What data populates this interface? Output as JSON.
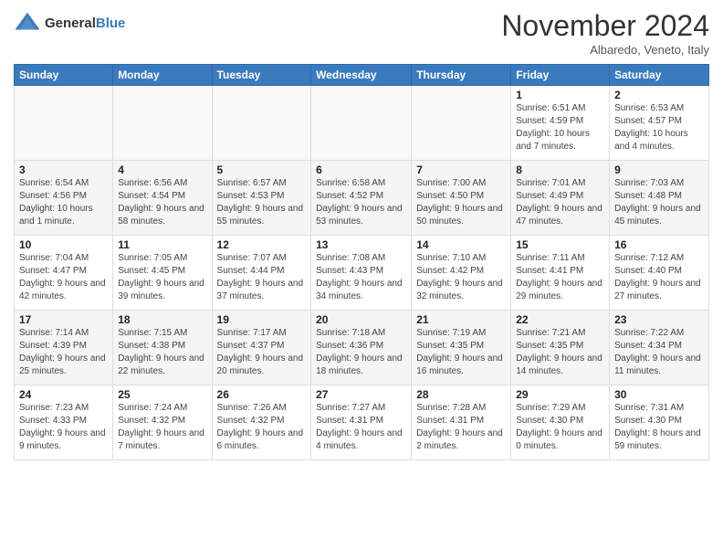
{
  "logo": {
    "general": "General",
    "blue": "Blue"
  },
  "header": {
    "month": "November 2024",
    "location": "Albaredo, Veneto, Italy"
  },
  "weekdays": [
    "Sunday",
    "Monday",
    "Tuesday",
    "Wednesday",
    "Thursday",
    "Friday",
    "Saturday"
  ],
  "weeks": [
    [
      {
        "day": "",
        "info": ""
      },
      {
        "day": "",
        "info": ""
      },
      {
        "day": "",
        "info": ""
      },
      {
        "day": "",
        "info": ""
      },
      {
        "day": "",
        "info": ""
      },
      {
        "day": "1",
        "info": "Sunrise: 6:51 AM\nSunset: 4:59 PM\nDaylight: 10 hours and 7 minutes."
      },
      {
        "day": "2",
        "info": "Sunrise: 6:53 AM\nSunset: 4:57 PM\nDaylight: 10 hours and 4 minutes."
      }
    ],
    [
      {
        "day": "3",
        "info": "Sunrise: 6:54 AM\nSunset: 4:56 PM\nDaylight: 10 hours and 1 minute."
      },
      {
        "day": "4",
        "info": "Sunrise: 6:56 AM\nSunset: 4:54 PM\nDaylight: 9 hours and 58 minutes."
      },
      {
        "day": "5",
        "info": "Sunrise: 6:57 AM\nSunset: 4:53 PM\nDaylight: 9 hours and 55 minutes."
      },
      {
        "day": "6",
        "info": "Sunrise: 6:58 AM\nSunset: 4:52 PM\nDaylight: 9 hours and 53 minutes."
      },
      {
        "day": "7",
        "info": "Sunrise: 7:00 AM\nSunset: 4:50 PM\nDaylight: 9 hours and 50 minutes."
      },
      {
        "day": "8",
        "info": "Sunrise: 7:01 AM\nSunset: 4:49 PM\nDaylight: 9 hours and 47 minutes."
      },
      {
        "day": "9",
        "info": "Sunrise: 7:03 AM\nSunset: 4:48 PM\nDaylight: 9 hours and 45 minutes."
      }
    ],
    [
      {
        "day": "10",
        "info": "Sunrise: 7:04 AM\nSunset: 4:47 PM\nDaylight: 9 hours and 42 minutes."
      },
      {
        "day": "11",
        "info": "Sunrise: 7:05 AM\nSunset: 4:45 PM\nDaylight: 9 hours and 39 minutes."
      },
      {
        "day": "12",
        "info": "Sunrise: 7:07 AM\nSunset: 4:44 PM\nDaylight: 9 hours and 37 minutes."
      },
      {
        "day": "13",
        "info": "Sunrise: 7:08 AM\nSunset: 4:43 PM\nDaylight: 9 hours and 34 minutes."
      },
      {
        "day": "14",
        "info": "Sunrise: 7:10 AM\nSunset: 4:42 PM\nDaylight: 9 hours and 32 minutes."
      },
      {
        "day": "15",
        "info": "Sunrise: 7:11 AM\nSunset: 4:41 PM\nDaylight: 9 hours and 29 minutes."
      },
      {
        "day": "16",
        "info": "Sunrise: 7:12 AM\nSunset: 4:40 PM\nDaylight: 9 hours and 27 minutes."
      }
    ],
    [
      {
        "day": "17",
        "info": "Sunrise: 7:14 AM\nSunset: 4:39 PM\nDaylight: 9 hours and 25 minutes."
      },
      {
        "day": "18",
        "info": "Sunrise: 7:15 AM\nSunset: 4:38 PM\nDaylight: 9 hours and 22 minutes."
      },
      {
        "day": "19",
        "info": "Sunrise: 7:17 AM\nSunset: 4:37 PM\nDaylight: 9 hours and 20 minutes."
      },
      {
        "day": "20",
        "info": "Sunrise: 7:18 AM\nSunset: 4:36 PM\nDaylight: 9 hours and 18 minutes."
      },
      {
        "day": "21",
        "info": "Sunrise: 7:19 AM\nSunset: 4:35 PM\nDaylight: 9 hours and 16 minutes."
      },
      {
        "day": "22",
        "info": "Sunrise: 7:21 AM\nSunset: 4:35 PM\nDaylight: 9 hours and 14 minutes."
      },
      {
        "day": "23",
        "info": "Sunrise: 7:22 AM\nSunset: 4:34 PM\nDaylight: 9 hours and 11 minutes."
      }
    ],
    [
      {
        "day": "24",
        "info": "Sunrise: 7:23 AM\nSunset: 4:33 PM\nDaylight: 9 hours and 9 minutes."
      },
      {
        "day": "25",
        "info": "Sunrise: 7:24 AM\nSunset: 4:32 PM\nDaylight: 9 hours and 7 minutes."
      },
      {
        "day": "26",
        "info": "Sunrise: 7:26 AM\nSunset: 4:32 PM\nDaylight: 9 hours and 6 minutes."
      },
      {
        "day": "27",
        "info": "Sunrise: 7:27 AM\nSunset: 4:31 PM\nDaylight: 9 hours and 4 minutes."
      },
      {
        "day": "28",
        "info": "Sunrise: 7:28 AM\nSunset: 4:31 PM\nDaylight: 9 hours and 2 minutes."
      },
      {
        "day": "29",
        "info": "Sunrise: 7:29 AM\nSunset: 4:30 PM\nDaylight: 9 hours and 0 minutes."
      },
      {
        "day": "30",
        "info": "Sunrise: 7:31 AM\nSunset: 4:30 PM\nDaylight: 8 hours and 59 minutes."
      }
    ]
  ]
}
